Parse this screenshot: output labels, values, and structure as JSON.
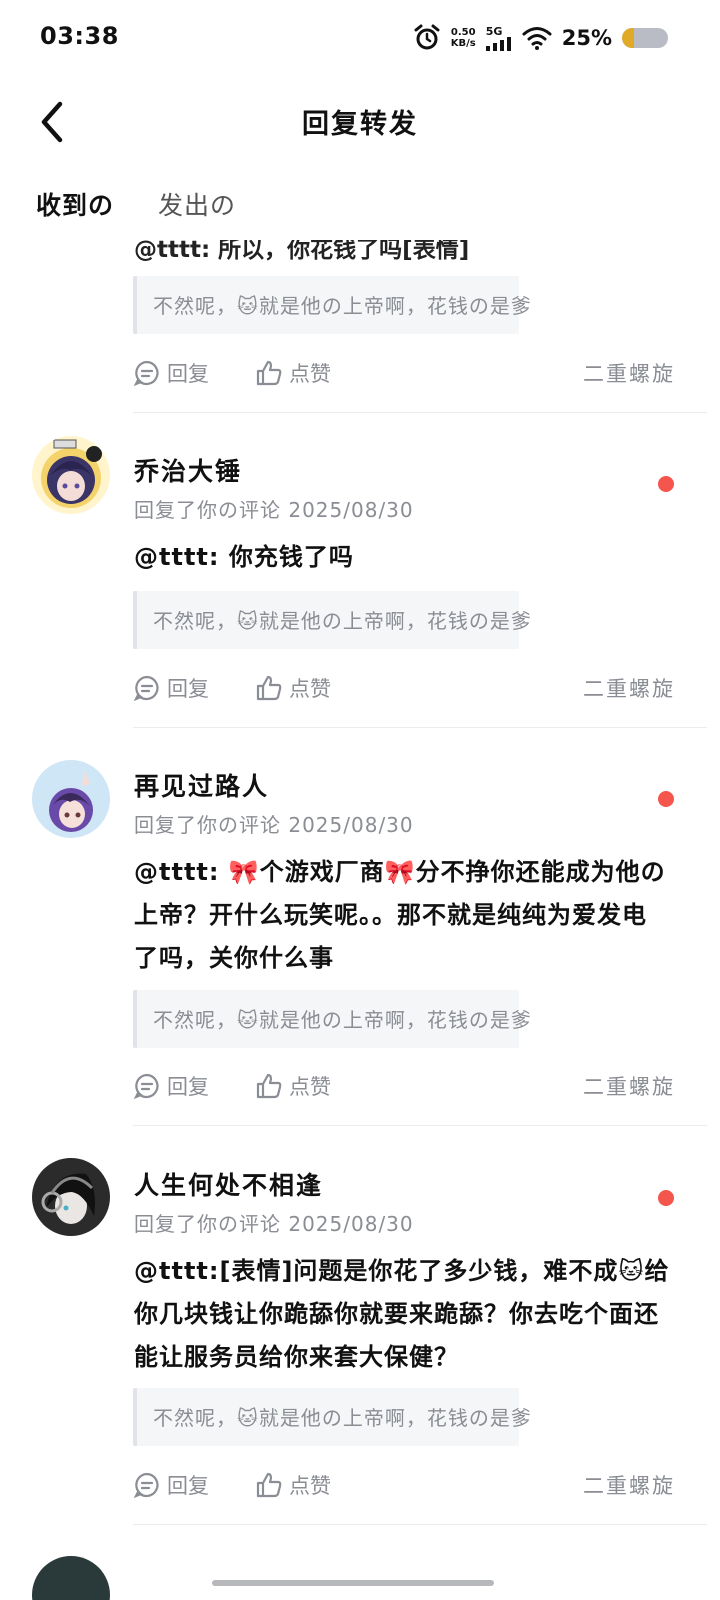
{
  "status_bar": {
    "time": "03:38",
    "net_speed_value": "0.50",
    "net_speed_unit": "KB/s",
    "network": "5G",
    "battery_percent": "25%",
    "battery_level": 0.25,
    "icons": [
      "alarm-icon",
      "signal-icon",
      "wifi-icon",
      "battery-icon"
    ]
  },
  "header": {
    "title": "回复转发",
    "back_icon": "chevron-left-icon"
  },
  "tabs": [
    {
      "label": "收到の",
      "active": true
    },
    {
      "label": "发出の",
      "active": false
    }
  ],
  "accent_color": "#2fcfc1",
  "unread_color": "#f4564e",
  "partial_top": {
    "comment_cutoff": "@tttt: 所以，你花钱了吗[表情]",
    "quote": "不然呢，🐱就是他の上帝啊，花钱の是爹",
    "reply_label": "回复",
    "like_label": "点赞",
    "author": "二重螺旋"
  },
  "notifications": [
    {
      "username": "乔治大锤",
      "meta": "回复了你の评论 2025/08/30",
      "comment": "@tttt: 你充钱了吗",
      "quote": "不然呢，🐱就是他の上帝啊，花钱の是爹",
      "reply_label": "回复",
      "like_label": "点赞",
      "author": "二重螺旋",
      "unread": true
    },
    {
      "username": "再见过路人",
      "meta": "回复了你の评论 2025/08/30",
      "comment": "@tttt: 🎀个游戏厂商🎀分不挣你还能成为他の上帝？开什么玩笑呢。。那不就是纯纯为爱发电了吗，关你什么事",
      "quote": "不然呢，🐱就是他の上帝啊，花钱の是爹",
      "reply_label": "回复",
      "like_label": "点赞",
      "author": "二重螺旋",
      "unread": true
    },
    {
      "username": "人生何处不相逢",
      "meta": "回复了你の评论 2025/08/30",
      "comment": "@tttt:[表情]问题是你花了多少钱，难不成🐱给你几块钱让你跪舔你就要来跪舔？你去吃个面还能让服务员给你来套大保健？",
      "quote": "不然呢，🐱就是他の上帝啊，花钱の是爹",
      "reply_label": "回复",
      "like_label": "点赞",
      "author": "二重螺旋",
      "unread": true
    }
  ]
}
